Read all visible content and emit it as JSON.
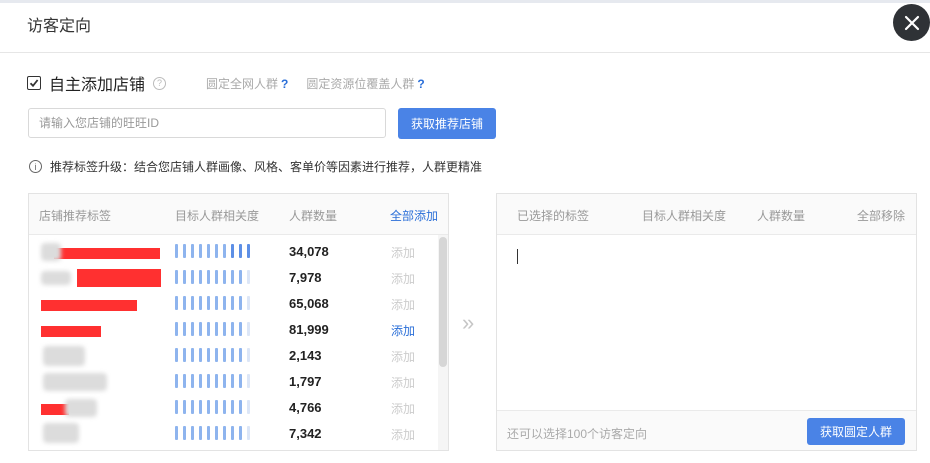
{
  "dialog": {
    "title": "访客定向"
  },
  "self_add": {
    "label": "自主添加店铺",
    "help_icon": "question-circle-icon",
    "link1": "圆定全网人群",
    "link2": "圆定资源位覆盖人群",
    "qmark": "?"
  },
  "search": {
    "placeholder": "请输入您店铺的旺旺ID",
    "button": "获取推荐店铺"
  },
  "tip": {
    "icon": "info-circle-icon",
    "text": "推荐标签升级：结合您店铺人群画像、风格、客单价等因素进行推荐，人群更精准"
  },
  "left_panel": {
    "columns": [
      "店铺推荐标签",
      "目标人群相关度",
      "人群数量",
      "全部添加"
    ],
    "rows": [
      {
        "relevance_level": 10,
        "count": "34,078",
        "add": "添加",
        "add_active": false
      },
      {
        "relevance_level": 9,
        "count": "7,978",
        "add": "添加",
        "add_active": false
      },
      {
        "relevance_level": 9,
        "count": "65,068",
        "add": "添加",
        "add_active": false
      },
      {
        "relevance_level": 9,
        "count": "81,999",
        "add": "添加",
        "add_active": true
      },
      {
        "relevance_level": 9,
        "count": "2,143",
        "add": "添加",
        "add_active": false
      },
      {
        "relevance_level": 9,
        "count": "1,797",
        "add": "添加",
        "add_active": false
      },
      {
        "relevance_level": 9,
        "count": "4,766",
        "add": "添加",
        "add_active": false
      },
      {
        "relevance_level": 9,
        "count": "7,342",
        "add": "添加",
        "add_active": false
      }
    ]
  },
  "transfer_icon": "»",
  "right_panel": {
    "columns": [
      "已选择的标签",
      "目标人群相关度",
      "人群数量",
      "全部移除"
    ],
    "footer_hint": "还可以选择100个访客定向",
    "button": "获取圆定人群"
  },
  "colors": {
    "accent": "#4a83e6",
    "link": "#2b6fd8",
    "close_bg": "#2f3236"
  }
}
